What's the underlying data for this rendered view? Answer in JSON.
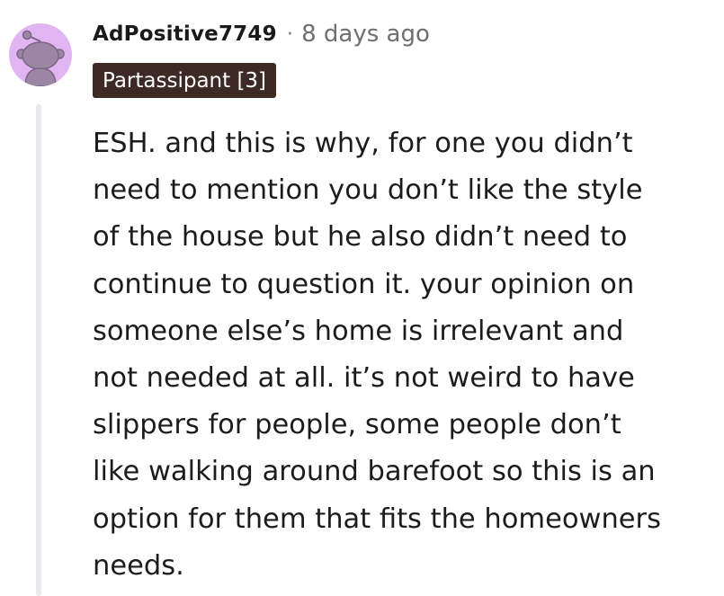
{
  "comment": {
    "author": "AdPositive7749",
    "separator": "·",
    "timestamp": "8 days ago",
    "flair": "Partassipant [3]",
    "body_lines": [
      "ESH. and this is why, for one you didn’t",
      "need to mention you don’t like the style",
      "of the house but he also didn’t need to",
      "continue to question it. your opinion on",
      "someone else’s home is irrelevant and",
      "not needed at all. it’s not weird to have",
      "slippers for people, some people don’t",
      "like walking around barefoot so this is an",
      "option for them that fits the homeowners",
      "needs."
    ]
  },
  "colors": {
    "avatar_background": "#e1b5f1",
    "avatar_figure": "#9b86a5",
    "flair_background": "#3e2a24",
    "flair_text": "#ffffff",
    "thread_line": "#e9eaec",
    "meta_text": "#6f6f6f"
  },
  "icons": {
    "avatar": "snoo-avatar-icon"
  }
}
